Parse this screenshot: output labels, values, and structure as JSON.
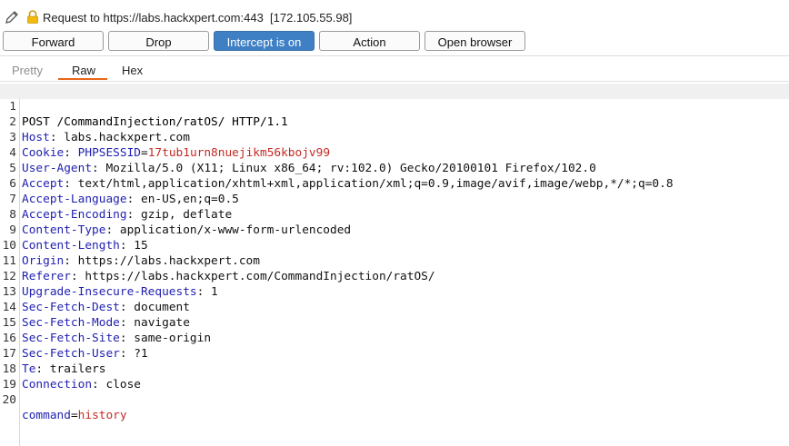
{
  "request_bar": {
    "label": "Request to https://labs.hackxpert.com:443",
    "ip": "[172.105.55.98]"
  },
  "toolbar": {
    "forward": "Forward",
    "drop": "Drop",
    "intercept": "Intercept is on",
    "action": "Action",
    "open_browser": "Open browser"
  },
  "tabs": {
    "pretty": "Pretty",
    "raw": "Raw",
    "hex": "Hex"
  },
  "request_lines": [
    {
      "n": "1",
      "text": "POST /CommandInjection/ratOS/ HTTP/1.1"
    },
    {
      "n": "2",
      "key": "Host",
      "value": "labs.hackxpert.com"
    },
    {
      "n": "3",
      "key": "Cookie",
      "cookie_name": "PHPSESSID",
      "cookie_value": "17tub1urn8nuejikm56kbojv99"
    },
    {
      "n": "4",
      "key": "User-Agent",
      "value": "Mozilla/5.0 (X11; Linux x86_64; rv:102.0) Gecko/20100101 Firefox/102.0"
    },
    {
      "n": "5",
      "key": "Accept",
      "value": "text/html,application/xhtml+xml,application/xml;q=0.9,image/avif,image/webp,*/*;q=0.8"
    },
    {
      "n": "6",
      "key": "Accept-Language",
      "value": "en-US,en;q=0.5"
    },
    {
      "n": "7",
      "key": "Accept-Encoding",
      "value": "gzip, deflate"
    },
    {
      "n": "8",
      "key": "Content-Type",
      "value": "application/x-www-form-urlencoded"
    },
    {
      "n": "9",
      "key": "Content-Length",
      "value": "15"
    },
    {
      "n": "10",
      "key": "Origin",
      "value": "https://labs.hackxpert.com"
    },
    {
      "n": "11",
      "key": "Referer",
      "value": "https://labs.hackxpert.com/CommandInjection/ratOS/"
    },
    {
      "n": "12",
      "key": "Upgrade-Insecure-Requests",
      "value": "1"
    },
    {
      "n": "13",
      "key": "Sec-Fetch-Dest",
      "value": "document"
    },
    {
      "n": "14",
      "key": "Sec-Fetch-Mode",
      "value": "navigate"
    },
    {
      "n": "15",
      "key": "Sec-Fetch-Site",
      "value": "same-origin"
    },
    {
      "n": "16",
      "key": "Sec-Fetch-User",
      "value": "?1"
    },
    {
      "n": "17",
      "key": "Te",
      "value": "trailers"
    },
    {
      "n": "18",
      "key": "Connection",
      "value": "close"
    },
    {
      "n": "19",
      "text": ""
    },
    {
      "n": "20",
      "param_name": "command",
      "param_value": "history"
    }
  ],
  "colors": {
    "intercept_on": "#3f7fc4",
    "tab_active_underline": "#e8671a",
    "header_key": "#1f1fb0",
    "cookie_value": "#c42a22"
  },
  "icons": [
    "pencil-icon",
    "lock-icon"
  ]
}
